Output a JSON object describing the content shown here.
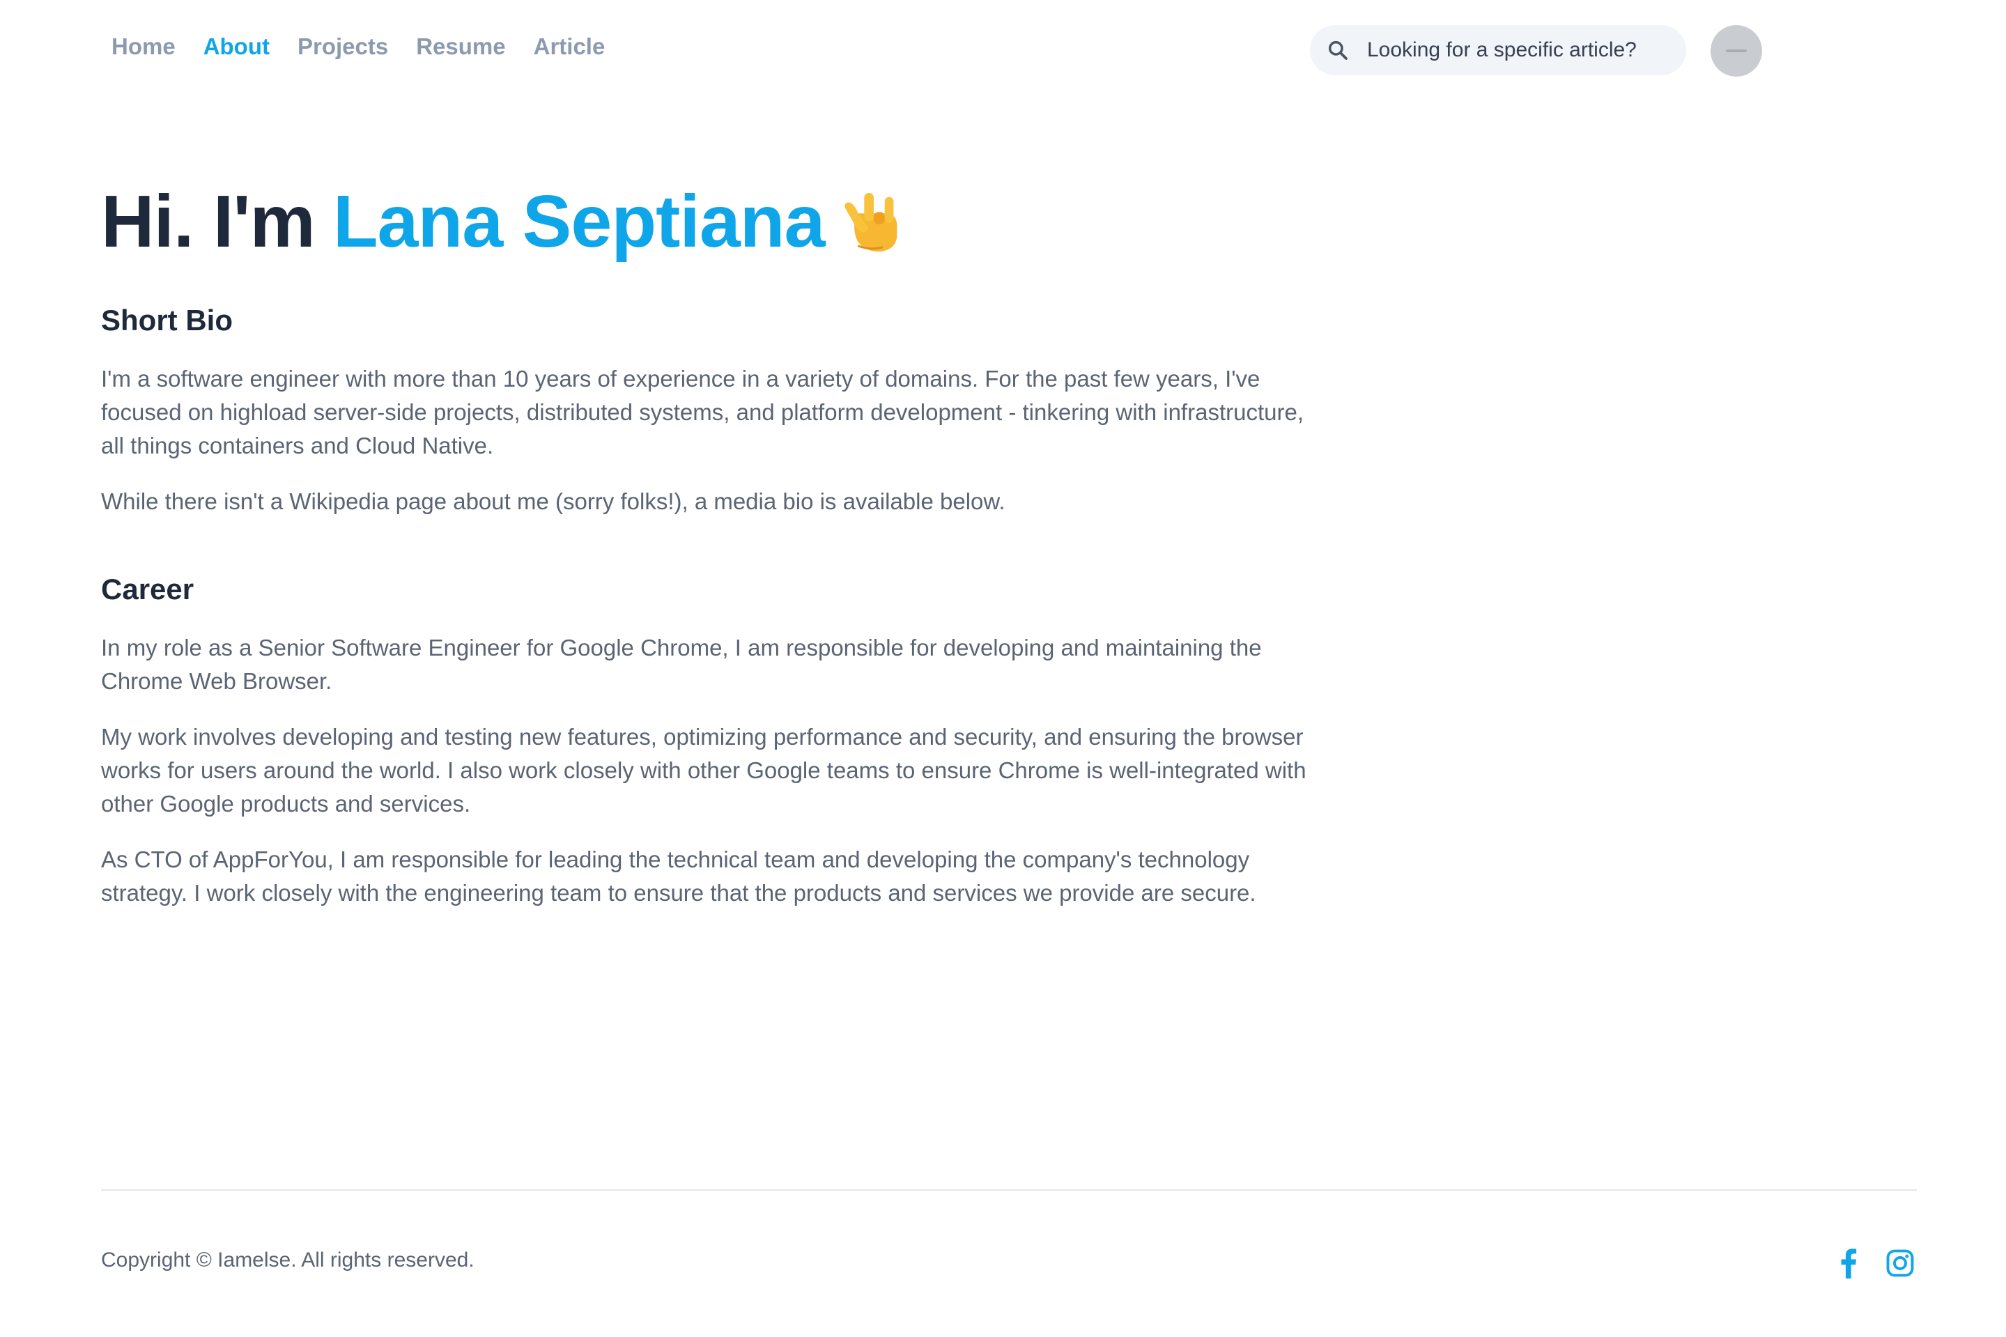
{
  "nav": {
    "items": [
      {
        "label": "Home"
      },
      {
        "label": "About"
      },
      {
        "label": "Projects"
      },
      {
        "label": "Resume"
      },
      {
        "label": "Article"
      }
    ],
    "active": "About"
  },
  "search": {
    "placeholder": "Looking for a specific article?",
    "icon": "search-icon"
  },
  "hero": {
    "greeting": "Hi. I'm",
    "name": "Lana Septiana",
    "emoji": "🤟"
  },
  "bio": {
    "title": "Short Bio",
    "paragraphs": [
      "I'm a software engineer with more than 10 years of experience in a variety of domains. For the past few years, I've focused on highload server-side projects, distributed systems, and platform development - tinkering with infrastructure, all things containers and Cloud Native.",
      "While there isn't a Wikipedia page about me (sorry folks!), a media bio is available below."
    ]
  },
  "career": {
    "title": "Career",
    "paragraphs": [
      "In my role as a Senior Software Engineer for Google Chrome, I am responsible for developing and maintaining the Chrome Web Browser.",
      "My work involves developing and testing new features, optimizing performance and security, and ensuring the browser works for users around the world. I also work closely with other Google teams to ensure Chrome is well-integrated with other Google products and services.",
      "As CTO of AppForYou, I am responsible for leading the technical team and developing the company's technology strategy. I work closely with the engineering team to ensure that the products and services we provide are secure."
    ]
  },
  "footer": {
    "copyright": "Copyright © Iamelse. All rights reserved.",
    "social": [
      {
        "icon": "facebook-icon"
      },
      {
        "icon": "instagram-icon"
      }
    ]
  },
  "colors": {
    "accent": "#0ea5e9",
    "heading": "#1e293b",
    "body_text": "#5b6474",
    "nav_inactive": "#8c9ab0",
    "search_bg": "#f1f4f8"
  }
}
